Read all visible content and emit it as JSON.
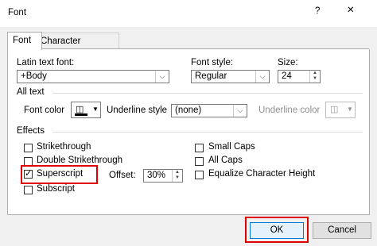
{
  "window": {
    "title": "Font",
    "help": "?",
    "close": "✕"
  },
  "tabs": [
    {
      "label": "Font",
      "active": true
    },
    {
      "label": "Character Spacing",
      "active": false
    }
  ],
  "latin_font": {
    "label": "Latin text font:",
    "value": "+Body"
  },
  "font_style": {
    "label": "Font style:",
    "value": "Regular"
  },
  "size": {
    "label": "Size:",
    "value": "24"
  },
  "all_text": {
    "heading": "All text",
    "font_color_label": "Font color",
    "underline_style_label": "Underline style",
    "underline_style_value": "(none)",
    "underline_color_label": "Underline color"
  },
  "effects": {
    "heading": "Effects",
    "left": [
      {
        "label": "Strikethrough",
        "checked": false
      },
      {
        "label": "Double Strikethrough",
        "checked": false
      },
      {
        "label": "Superscript",
        "checked": true
      },
      {
        "label": "Subscript",
        "checked": false
      }
    ],
    "right": [
      {
        "label": "Small Caps",
        "checked": false
      },
      {
        "label": "All Caps",
        "checked": false
      },
      {
        "label": "Equalize Character Height",
        "checked": false
      }
    ],
    "offset_label": "Offset:",
    "offset_value": "30%"
  },
  "buttons": {
    "ok": "OK",
    "cancel": "Cancel"
  },
  "colors": {
    "highlight": "#e00000",
    "ok_border": "#0078d7"
  }
}
